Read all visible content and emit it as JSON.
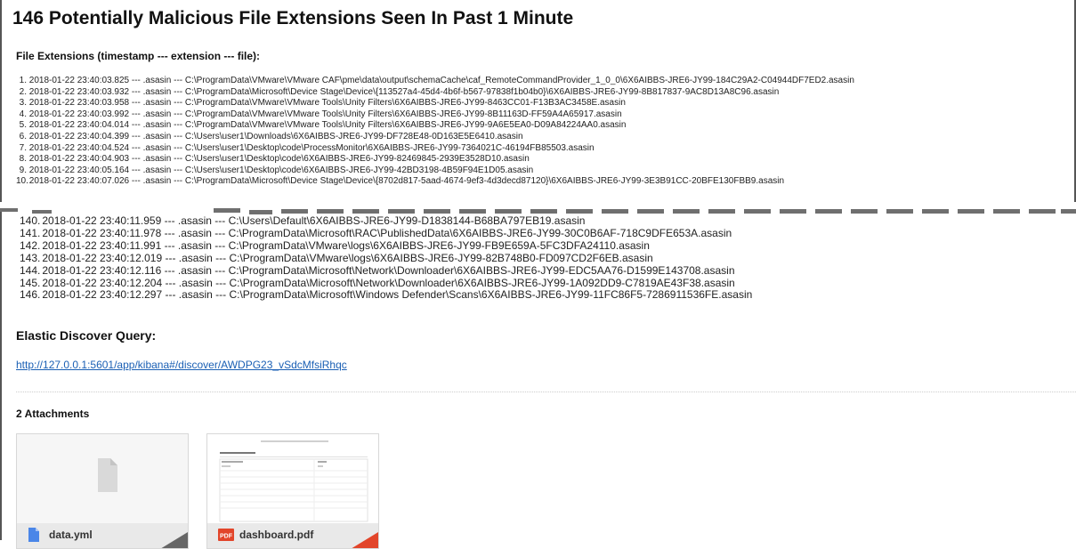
{
  "header": {
    "title": "146 Potentially Malicious File Extensions Seen In Past 1 Minute",
    "subtitle": "File Extensions (timestamp --- extension --- file):"
  },
  "first_entries": [
    {
      "num": "1.",
      "text": "2018-01-22 23:40:03.825 --- .asasin --- C:\\ProgramData\\VMware\\VMware CAF\\pme\\data\\output\\schemaCache\\caf_RemoteCommandProvider_1_0_0\\6X6AIBBS-JRE6-JY99-184C29A2-C04944DF7ED2.asasin"
    },
    {
      "num": "2.",
      "text": "2018-01-22 23:40:03.932 --- .asasin --- C:\\ProgramData\\Microsoft\\Device Stage\\Device\\{113527a4-45d4-4b6f-b567-97838f1b04b0}\\6X6AIBBS-JRE6-JY99-8B817837-9AC8D13A8C96.asasin"
    },
    {
      "num": "3.",
      "text": "2018-01-22 23:40:03.958 --- .asasin --- C:\\ProgramData\\VMware\\VMware Tools\\Unity Filters\\6X6AIBBS-JRE6-JY99-8463CC01-F13B3AC3458E.asasin"
    },
    {
      "num": "4.",
      "text": "2018-01-22 23:40:03.992 --- .asasin --- C:\\ProgramData\\VMware\\VMware Tools\\Unity Filters\\6X6AIBBS-JRE6-JY99-8B11163D-FF59A4A65917.asasin"
    },
    {
      "num": "5.",
      "text": "2018-01-22 23:40:04.014 --- .asasin --- C:\\ProgramData\\VMware\\VMware Tools\\Unity Filters\\6X6AIBBS-JRE6-JY99-9A6E5EA0-D09A84224AA0.asasin"
    },
    {
      "num": "6.",
      "text": "2018-01-22 23:40:04.399 --- .asasin --- C:\\Users\\user1\\Downloads\\6X6AIBBS-JRE6-JY99-DF728E48-0D163E5E6410.asasin"
    },
    {
      "num": "7.",
      "text": "2018-01-22 23:40:04.524 --- .asasin --- C:\\Users\\user1\\Desktop\\code\\ProcessMonitor\\6X6AIBBS-JRE6-JY99-7364021C-46194FB85503.asasin"
    },
    {
      "num": "8.",
      "text": "2018-01-22 23:40:04.903 --- .asasin --- C:\\Users\\user1\\Desktop\\code\\6X6AIBBS-JRE6-JY99-82469845-2939E3528D10.asasin"
    },
    {
      "num": "9.",
      "text": "2018-01-22 23:40:05.164 --- .asasin --- C:\\Users\\user1\\Desktop\\code\\6X6AIBBS-JRE6-JY99-42BD3198-4B59F94E1D05.asasin"
    },
    {
      "num": "10.",
      "text": "2018-01-22 23:40:07.026 --- .asasin --- C:\\ProgramData\\Microsoft\\Device Stage\\Device\\{8702d817-5aad-4674-9ef3-4d3decd87120}\\6X6AIBBS-JRE6-JY99-3E3B91CC-20BFE130FBB9.asasin"
    }
  ],
  "last_entries": [
    {
      "num": "140.",
      "text": "2018-01-22 23:40:11.959 --- .asasin --- C:\\Users\\Default\\6X6AIBBS-JRE6-JY99-D1838144-B68BA797EB19.asasin"
    },
    {
      "num": "141.",
      "text": "2018-01-22 23:40:11.978 --- .asasin --- C:\\ProgramData\\Microsoft\\RAC\\PublishedData\\6X6AIBBS-JRE6-JY99-30C0B6AF-718C9DFE653A.asasin"
    },
    {
      "num": "142.",
      "text": "2018-01-22 23:40:11.991 --- .asasin --- C:\\ProgramData\\VMware\\logs\\6X6AIBBS-JRE6-JY99-FB9E659A-5FC3DFA24110.asasin"
    },
    {
      "num": "143.",
      "text": "2018-01-22 23:40:12.019 --- .asasin --- C:\\ProgramData\\VMware\\logs\\6X6AIBBS-JRE6-JY99-82B748B0-FD097CD2F6EB.asasin"
    },
    {
      "num": "144.",
      "text": "2018-01-22 23:40:12.116 --- .asasin --- C:\\ProgramData\\Microsoft\\Network\\Downloader\\6X6AIBBS-JRE6-JY99-EDC5AA76-D1599E143708.asasin"
    },
    {
      "num": "145.",
      "text": "2018-01-22 23:40:12.204 --- .asasin --- C:\\ProgramData\\Microsoft\\Network\\Downloader\\6X6AIBBS-JRE6-JY99-1A092DD9-C7819AE43F38.asasin"
    },
    {
      "num": "146.",
      "text": "2018-01-22 23:40:12.297 --- .asasin --- C:\\ProgramData\\Microsoft\\Windows Defender\\Scans\\6X6AIBBS-JRE6-JY99-11FC86F5-7286911536FE.asasin"
    }
  ],
  "query": {
    "title": "Elastic Discover Query:",
    "link": "http://127.0.0.1:5601/app/kibana#/discover/AWDPG23_vSdcMfsiRhqc"
  },
  "attachments": {
    "title": "2 Attachments",
    "items": [
      {
        "name": "data.yml",
        "icon": "file-icon",
        "color": "#4a86e8"
      },
      {
        "name": "dashboard.pdf",
        "icon": "pdf-icon",
        "color": "#e2452a"
      }
    ]
  }
}
